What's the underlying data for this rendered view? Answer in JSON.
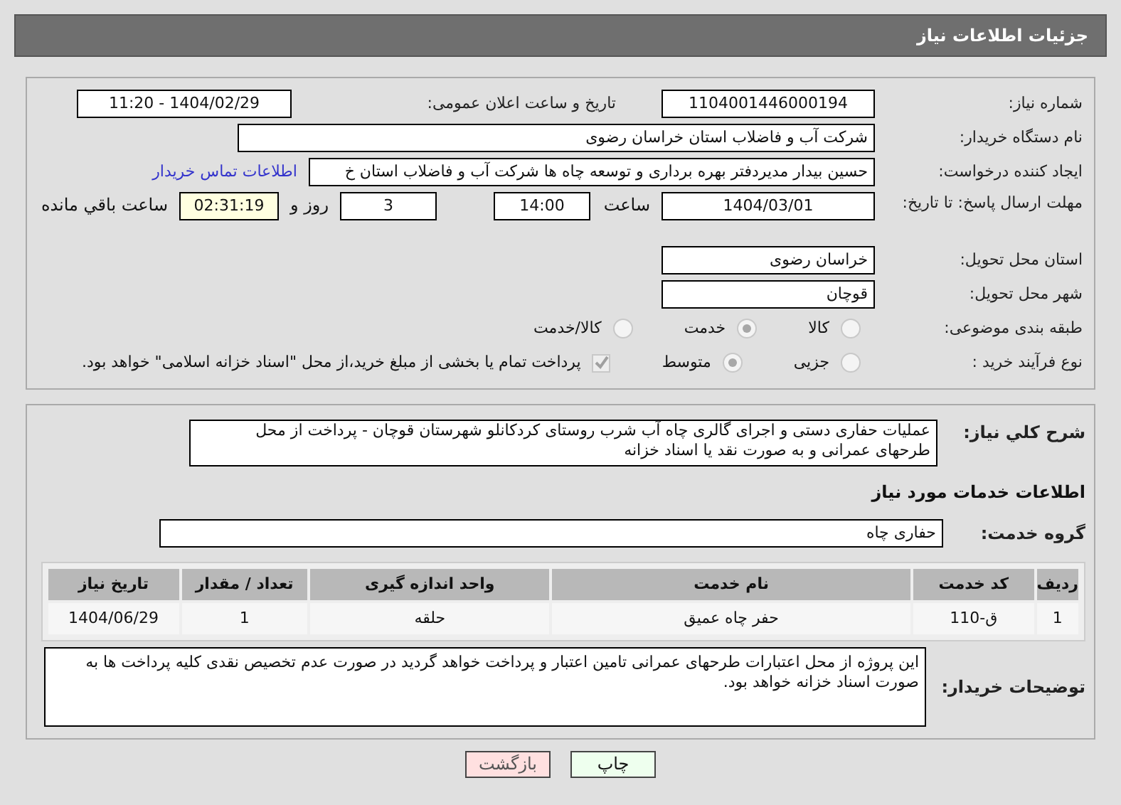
{
  "header": {
    "title": "جزئیات اطلاعات نیاز"
  },
  "details": {
    "need_number": {
      "label": "شماره نیاز:",
      "value": "1104001446000194"
    },
    "announce": {
      "label": "تاریخ و ساعت اعلان عمومی:",
      "value": "1404/02/29 - 11:20"
    },
    "buyer": {
      "label": "نام دستگاه خریدار:",
      "value": "شرکت آب و فاضلاب استان خراسان رضوی"
    },
    "creator": {
      "label": "ایجاد کننده درخواست:",
      "value": "حسین  بیدار مدیردفتر بهره برداری و توسعه چاه ها شرکت آب و فاضلاب استان خ",
      "link": "اطلاعات تماس خریدار"
    },
    "deadline": {
      "label": "مهلت ارسال پاسخ: تا تاریخ:",
      "date": "1404/03/01",
      "time_label": "ساعت",
      "time": "14:00",
      "days": "3",
      "days_label": "روز و",
      "remaining": "02:31:19",
      "remaining_label": "ساعت باقي مانده"
    },
    "province": {
      "label": "استان محل تحویل:",
      "value": "خراسان رضوی"
    },
    "city": {
      "label": "شهر محل تحویل:",
      "value": "قوچان"
    },
    "category": {
      "label": "طبقه بندی موضوعی:",
      "options": [
        {
          "label": "کالا",
          "selected": false
        },
        {
          "label": "خدمت",
          "selected": true
        },
        {
          "label": "کالا/خدمت",
          "selected": false
        }
      ]
    },
    "process": {
      "label": "نوع فرآیند خرید :",
      "options": [
        {
          "label": "جزیی",
          "selected": false
        },
        {
          "label": "متوسط",
          "selected": true
        }
      ],
      "payment": {
        "label": "پرداخت تمام یا بخشی از مبلغ خرید،از محل \"اسناد خزانه اسلامی\" خواهد بود.",
        "checked": true
      }
    }
  },
  "summary": {
    "label": "شرح کلي نیاز:",
    "value": "عملیات حفاری دستی و اجرای گالری چاه آب شرب روستای کردکانلو شهرستان قوچان - پرداخت از محل طرحهای عمرانی و به صورت نقد یا اسناد خزانه"
  },
  "services_heading": "اطلاعات خدمات مورد نیاز",
  "service_group": {
    "label": "گروه خدمت:",
    "value": "حفاری چاه"
  },
  "table": {
    "columns": [
      "ردیف",
      "کد خدمت",
      "نام خدمت",
      "واحد اندازه گیری",
      "تعداد / مقدار",
      "تاریخ نیاز"
    ],
    "rows": [
      [
        "1",
        "ق-110",
        "حفر چاه عمیق",
        "حلقه",
        "1",
        "1404/06/29"
      ]
    ]
  },
  "notes": {
    "label": "توضیحات خریدار:",
    "value": "این پروژه از محل اعتبارات طرحهای عمرانی تامین اعتبار و پرداخت خواهد گردید در صورت عدم تخصیص نقدی کلیه پرداخت ها به صورت اسناد خزانه خواهد بود."
  },
  "buttons": [
    {
      "label": "چاپ",
      "kind": "print"
    },
    {
      "label": "بازگشت",
      "kind": "back"
    }
  ]
}
